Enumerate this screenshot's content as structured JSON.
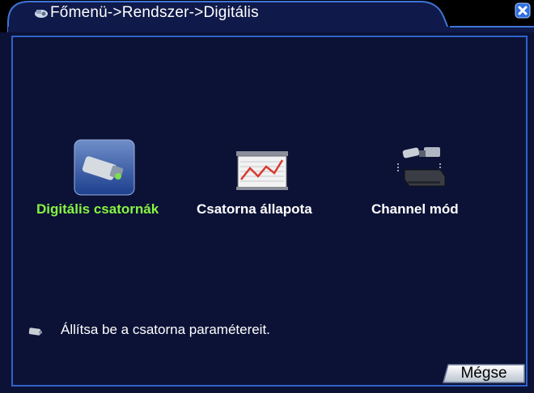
{
  "header": {
    "breadcrumb": "Főmenü->Rendszer->Digitális",
    "close_icon": "close-icon",
    "colors": {
      "tab": "#0f1a4a",
      "tab_border": "#3f74d8",
      "close": "#2f6fe0"
    }
  },
  "menu": {
    "items": [
      {
        "label": "Digitális csatornák",
        "icon": "ip-camera-icon",
        "selected": true
      },
      {
        "label": "Csatorna állapota",
        "icon": "status-chart-icon",
        "selected": false
      },
      {
        "label": "Channel mód",
        "icon": "channel-mode-icon",
        "selected": false
      }
    ],
    "selected_color": "#86f542"
  },
  "hint": {
    "icon": "camera-small-icon",
    "text": "Állítsa be a csatorna paramétereit."
  },
  "buttons": {
    "cancel_label": "Mégse"
  }
}
